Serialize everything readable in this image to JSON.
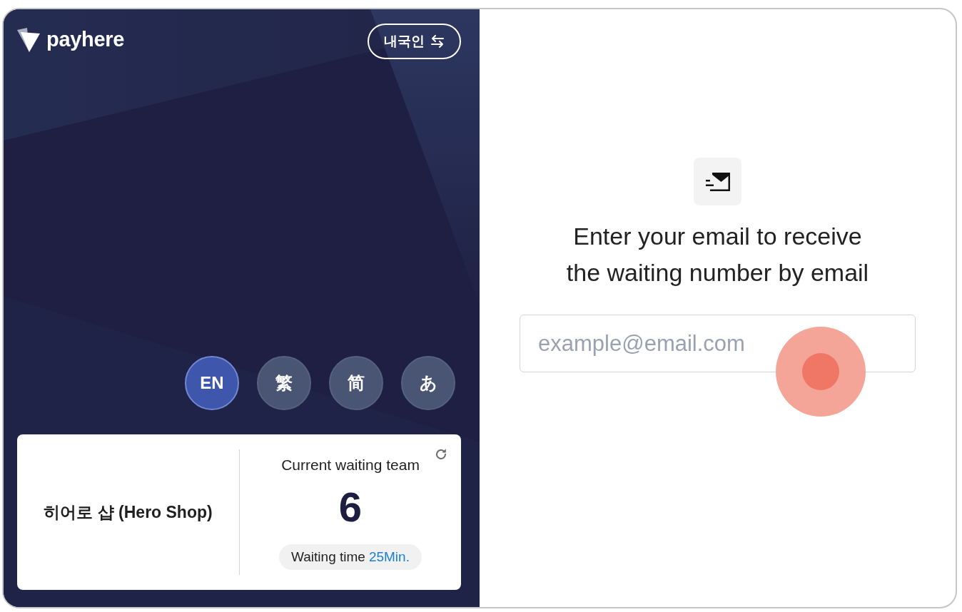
{
  "header": {
    "logo": "payhere",
    "residency_toggle": {
      "label": "내국인"
    }
  },
  "languages": [
    {
      "label": "EN",
      "selected": true
    },
    {
      "label": "繁",
      "selected": false
    },
    {
      "label": "简",
      "selected": false
    },
    {
      "label": "あ",
      "selected": false
    }
  ],
  "store_card": {
    "store_name": "히어로 샵 (Hero Shop)",
    "waiting_label": "Current waiting team",
    "waiting_count": "6",
    "waiting_time_label": "Waiting time",
    "waiting_time_value": "25Min."
  },
  "email_form": {
    "prompt": "Enter your email to receive\nthe waiting number by email",
    "email_field": {
      "placeholder": "example@email.com"
    }
  }
}
